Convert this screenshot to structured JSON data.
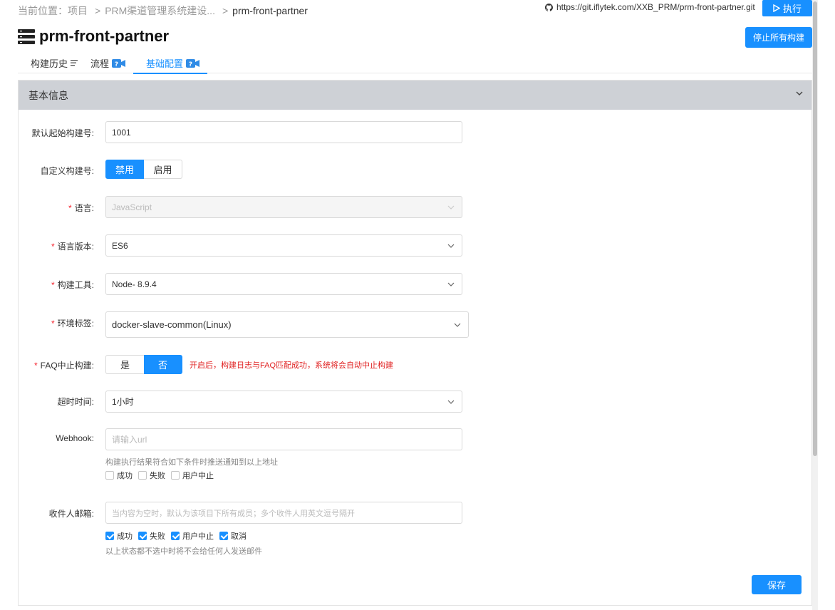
{
  "breadcrumb": {
    "prefix": "当前位置：",
    "items": [
      "项目",
      "PRM渠道管理系统建设...",
      "prm-front-partner"
    ],
    "separator": ">"
  },
  "repo": {
    "url": "https://git.iflytek.com/XXB_PRM/prm-front-partner.git",
    "icon": "github-icon"
  },
  "header": {
    "run_label": "执行",
    "title": "prm-front-partner",
    "stop_all_label": "停止所有构建"
  },
  "tabs": [
    {
      "label": "构建历史",
      "icon": "list-icon",
      "active": false
    },
    {
      "label": "流程",
      "icon": "video-help-icon",
      "active": false
    },
    {
      "label": "基础配置",
      "icon": "video-help-icon",
      "active": true
    }
  ],
  "panel": {
    "title": "基本信息",
    "fields": {
      "start_number": {
        "label": "默认起始构建号:",
        "value": "1001"
      },
      "custom_number": {
        "label": "自定义构建号:",
        "options": [
          "禁用",
          "启用"
        ],
        "selected": "禁用"
      },
      "language": {
        "label": "语言:",
        "required": true,
        "value": "JavaScript",
        "disabled": true
      },
      "language_version": {
        "label": "语言版本:",
        "required": true,
        "value": "ES6"
      },
      "build_tool": {
        "label": "构建工具:",
        "required": true,
        "value": "Node- 8.9.4"
      },
      "env_tag": {
        "label": "环境标签:",
        "required": true,
        "value": "docker-slave-common(Linux)"
      },
      "faq_abort": {
        "label": "FAQ中止构建:",
        "required": true,
        "options": [
          "是",
          "否"
        ],
        "selected": "否",
        "hint": "开启后，构建日志与FAQ匹配成功，系统将会自动中止构建"
      },
      "timeout": {
        "label": "超时时间:",
        "value": "1小时"
      },
      "webhook": {
        "label": "Webhook:",
        "placeholder": "请输入url",
        "hint": "构建执行结果符合如下条件时推送通知到以上地址",
        "checks": [
          {
            "label": "成功",
            "checked": false
          },
          {
            "label": "失败",
            "checked": false
          },
          {
            "label": "用户中止",
            "checked": false
          }
        ]
      },
      "recipients": {
        "label": "收件人邮箱:",
        "placeholder": "当内容为空时，默认为该项目下所有成员；多个收件人用英文逗号隔开",
        "checks": [
          {
            "label": "成功",
            "checked": true
          },
          {
            "label": "失败",
            "checked": true
          },
          {
            "label": "用户中止",
            "checked": true
          },
          {
            "label": "取消",
            "checked": true
          }
        ],
        "hint": "以上状态都不选中时将不会给任何人发送邮件"
      }
    },
    "save_label": "保存"
  },
  "colors": {
    "accent": "#1890ff",
    "panel_header": "#ced1d6",
    "error": "#e02020",
    "required": "#f5222d"
  }
}
